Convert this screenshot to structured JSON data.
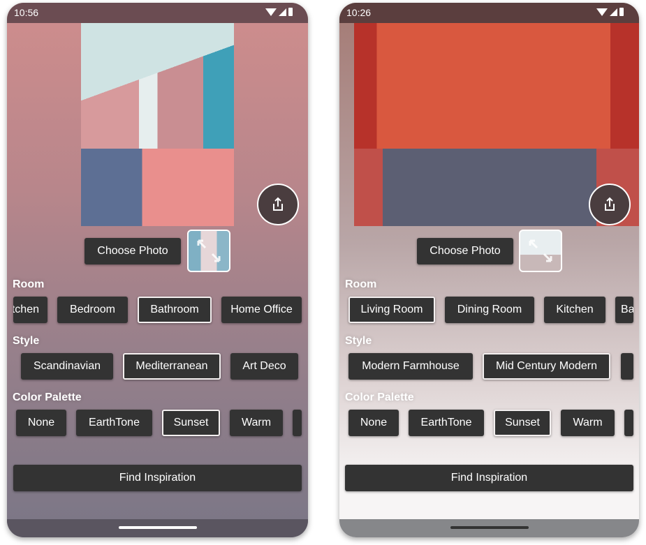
{
  "phones": [
    {
      "time": "10:56",
      "choose_photo": "Choose Photo",
      "room_label": "Room",
      "style_label": "Style",
      "palette_label": "Color Palette",
      "find_button": "Find Inspiration",
      "share_icon": "share-icon",
      "rooms": [
        "Kitchen",
        "Bedroom",
        "Bathroom",
        "Home Office"
      ],
      "selected_room": "Bathroom",
      "styles": [
        "Scandinavian",
        "Mediterranean",
        "Art Deco"
      ],
      "selected_style": "Mediterranean",
      "palettes": [
        "None",
        "EarthTone",
        "Sunset",
        "Warm",
        ""
      ],
      "selected_palette": "Sunset"
    },
    {
      "time": "10:26",
      "choose_photo": "Choose Photo",
      "room_label": "Room",
      "style_label": "Style",
      "palette_label": "Color Palette",
      "find_button": "Find Inspiration",
      "share_icon": "share-icon",
      "rooms": [
        "Living Room",
        "Dining Room",
        "Kitchen",
        "Bathroom"
      ],
      "selected_room": "Living Room",
      "styles": [
        "Modern Farmhouse",
        "Mid Century Modern",
        ""
      ],
      "selected_style": "Mid Century Modern",
      "palettes": [
        "None",
        "EarthTone",
        "Sunset",
        "Warm",
        ""
      ],
      "selected_palette": "Sunset"
    }
  ]
}
